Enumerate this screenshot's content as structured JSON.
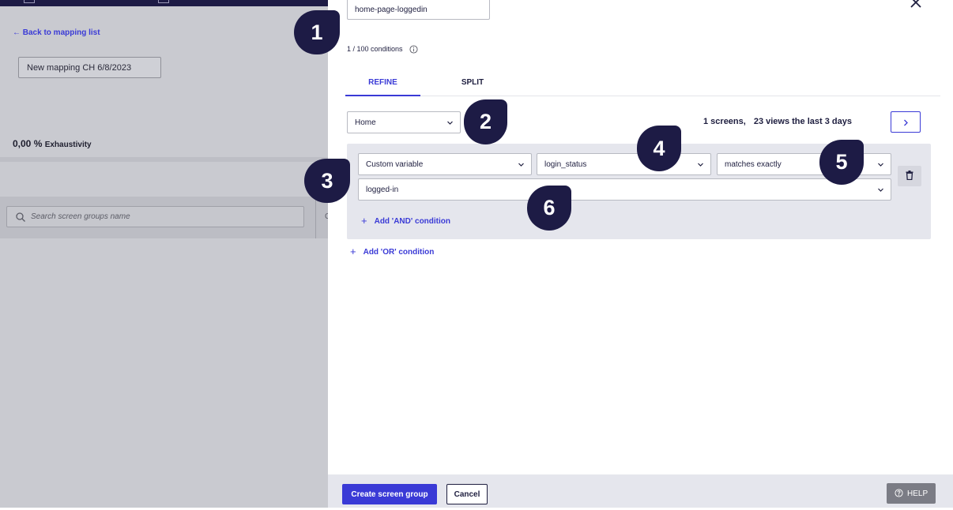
{
  "left_pane": {
    "back_link": "← Back to mapping list",
    "mapping_name": "New mapping CH 6/8/2023",
    "exhaustivity_value": "0,00 %",
    "exhaustivity_label": "Exhaustivity",
    "search_placeholder": "Search screen groups name",
    "column_fragment": "C"
  },
  "panel": {
    "group_name": "home-page-loggedin",
    "conditions_count": "1 / 100 conditions",
    "tabs": [
      {
        "label": "REFINE",
        "active": true
      },
      {
        "label": "SPLIT",
        "active": false
      }
    ],
    "screen_select": "Home",
    "screens_count": "1 screens,",
    "views_text": "23 views the last 3 days",
    "condition": {
      "type": "Custom variable",
      "key": "login_status",
      "operator": "matches exactly",
      "value": "logged-in",
      "add_and": "Add 'AND' condition"
    },
    "add_or": "Add 'OR' condition"
  },
  "footer": {
    "create_label": "Create screen group",
    "cancel_label": "Cancel",
    "help_label": "HELP"
  },
  "callouts": [
    "1",
    "2",
    "3",
    "4",
    "5",
    "6"
  ],
  "colors": {
    "accent": "#3a3ad6",
    "navy": "#1d1b45",
    "overlay": "#c9cad0",
    "condition_bg": "#e5e6ed"
  },
  "icons": [
    "close-icon",
    "info-icon",
    "chevron-down-icon",
    "chevron-right-icon",
    "trash-icon",
    "search-icon",
    "plus-icon",
    "help-icon"
  ]
}
